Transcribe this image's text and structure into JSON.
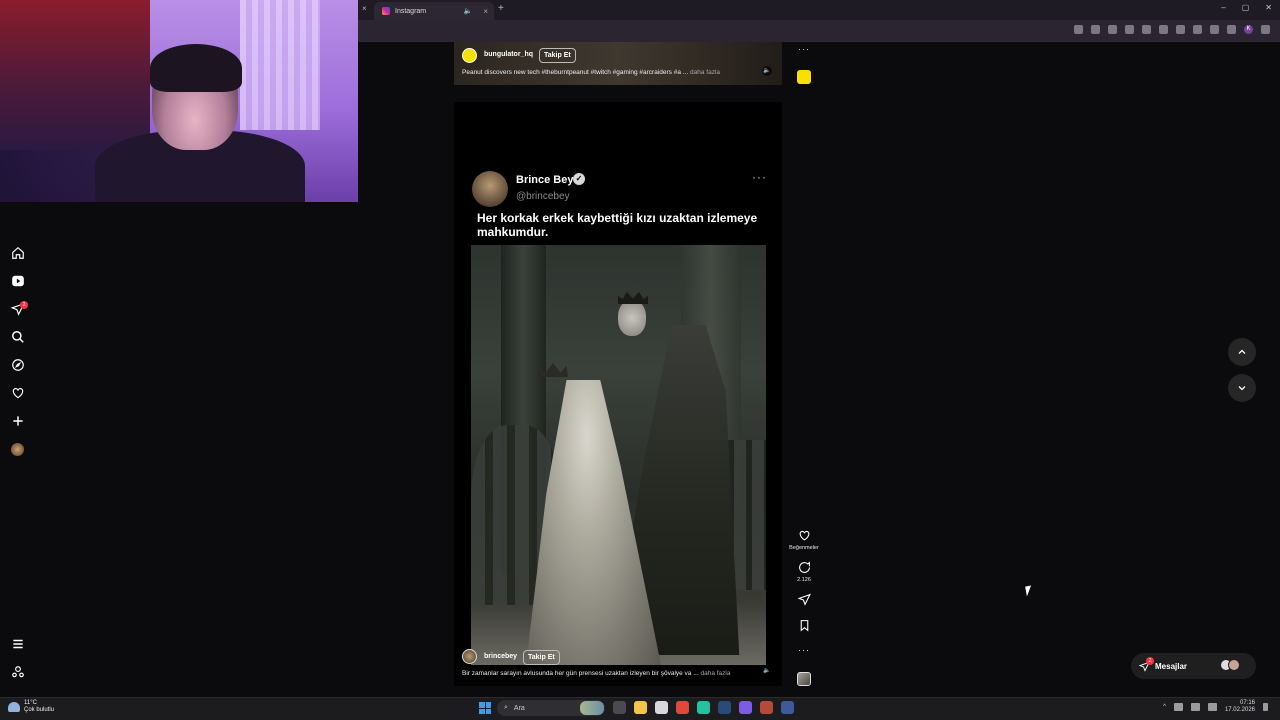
{
  "browser": {
    "tab_title": "Instagram",
    "prev_tab_close": "×",
    "tab_close": "×",
    "new_tab": "+",
    "window_controls": [
      "–",
      "▢",
      "✕"
    ],
    "profile_initial": "K"
  },
  "sidebar": {
    "notification_count": "2"
  },
  "prev_reel": {
    "username": "bungulator_hq",
    "follow_label": "Takip Et",
    "caption": "Peanut discovers new tech #theburntpeanut #twitch #gaming #arcraiders #a ...",
    "more_label": "daha fazla",
    "more_options": "···"
  },
  "reel": {
    "tweet": {
      "name": "Brince Bey",
      "verified_mark": "✓",
      "handle": "@brincebey",
      "more": "···",
      "text": "Her korkak erkek kaybettiği kızı uzaktan izlemeye mahkumdur."
    },
    "username": "brincebey",
    "follow_label": "Takip Et",
    "caption": "Bir zamanlar sarayın avlusunda her gün prensesi uzaktan izleyen bir şövalye va ...",
    "more_label": "daha fazla"
  },
  "actions": {
    "likes_label": "Beğenmeler",
    "comments_count": "2.126",
    "more": "···"
  },
  "messages": {
    "label": "Mesajlar",
    "badge": "2"
  },
  "taskbar": {
    "temperature": "11°C",
    "weather": "Çok bulutlu",
    "search_placeholder": "Ara",
    "time": "07:16",
    "date": "17.02.2026"
  },
  "colors": {
    "background": "#0b0b0d",
    "notification_badge": "#ff3040",
    "tray_weather": "#8fb3d9"
  }
}
